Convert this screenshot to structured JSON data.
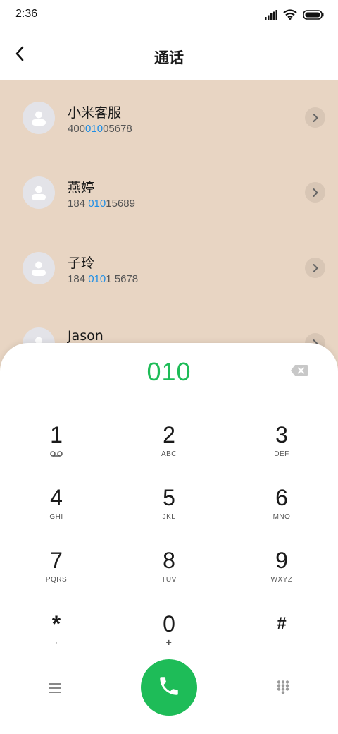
{
  "status": {
    "time": "2:36"
  },
  "header": {
    "title": "通话"
  },
  "contacts": [
    {
      "name": "小米客服",
      "number_pre": "400",
      "number_hl": "010",
      "number_post": "05678"
    },
    {
      "name": "燕婷",
      "number_pre": "184 ",
      "number_hl": "010",
      "number_post": "15689"
    },
    {
      "name": "子玲",
      "number_pre": "184 ",
      "number_hl": "010",
      "number_post": "1 5678"
    },
    {
      "name": "Jason",
      "number_pre": "",
      "number_hl": "",
      "number_post": ""
    }
  ],
  "dialer": {
    "input": "010",
    "keys": [
      {
        "digit": "1",
        "letters": ""
      },
      {
        "digit": "2",
        "letters": "ABC"
      },
      {
        "digit": "3",
        "letters": "DEF"
      },
      {
        "digit": "4",
        "letters": "GHI"
      },
      {
        "digit": "5",
        "letters": "JKL"
      },
      {
        "digit": "6",
        "letters": "MNO"
      },
      {
        "digit": "7",
        "letters": "PQRS"
      },
      {
        "digit": "8",
        "letters": "TUV"
      },
      {
        "digit": "9",
        "letters": "WXYZ"
      },
      {
        "digit": "*",
        "letters": ","
      },
      {
        "digit": "0",
        "letters": "+"
      },
      {
        "digit": "#",
        "letters": ""
      }
    ]
  },
  "colors": {
    "accent_green": "#1ebc58",
    "highlight_blue": "#1e8ee6",
    "list_background": "#e8d5c3"
  },
  "icons": [
    "back-arrow-icon",
    "signal-icon",
    "wifi-icon",
    "battery-icon",
    "contact-avatar-icon",
    "chevron-right-icon",
    "delete-icon",
    "voicemail-icon",
    "menu-icon",
    "phone-icon",
    "dialpad-icon"
  ]
}
